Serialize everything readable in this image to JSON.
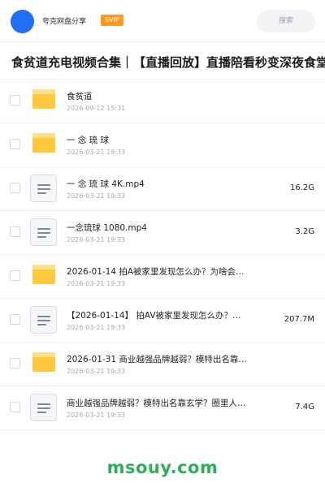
{
  "header": {
    "site_name": "夸克网盘分享",
    "badge": "SVIP",
    "search_placeholder": "搜索"
  },
  "share_title": "食贫道充电视频合集｜【直播回放】直播陪看秒变深夜食堂",
  "files": [
    {
      "type": "folder",
      "name": "食贫道",
      "date": "2026-09-12 15:31",
      "size": ""
    },
    {
      "type": "folder",
      "name": "一 念 琉 球",
      "date": "2026-03-21 19:33",
      "size": ""
    },
    {
      "type": "file",
      "name": "一 念 琉 球 4K.mp4",
      "date": "2026-03-21 19:33",
      "size": "16.2G"
    },
    {
      "type": "file",
      "name": "一念琉球 1080.mp4",
      "date": "2026-03-21 19:33",
      "size": "3.2G"
    },
    {
      "type": "folder",
      "name": "2026-01-14 拍A被家里发现怎么办？为啥会…",
      "date": "2026-03-21 19:33",
      "size": ""
    },
    {
      "type": "file",
      "name": "【2026-01-14】 拍AV被家里发现怎么办？…",
      "date": "2026-03-21 19:33",
      "size": "207.7M"
    },
    {
      "type": "folder",
      "name": "2026-01-31 商业越强品牌越弱？模特出名靠…",
      "date": "2026-03-21 19:33",
      "size": ""
    },
    {
      "type": "file",
      "name": "商业越强品牌越弱？模特出名靠玄学？圈里人视角锐评时…",
      "date": "2026-03-21 19:33",
      "size": "7.4G"
    }
  ],
  "watermark": "msouy.com",
  "colors": {
    "avatar": "#1f6ff0",
    "svip_badge": "#ff9a1f",
    "folder": "#ffc83d",
    "watermark": "#2fae59"
  }
}
